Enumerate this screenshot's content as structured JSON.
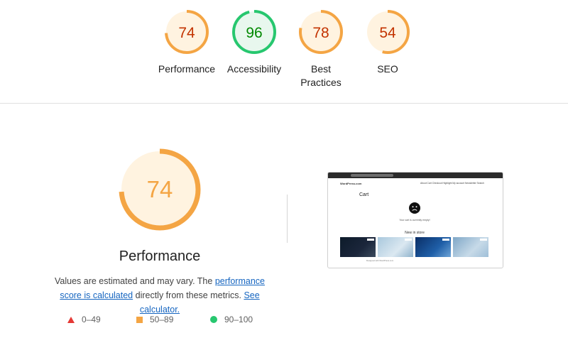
{
  "scores": [
    {
      "label": "Performance",
      "score": "74",
      "value": 0.74,
      "color": "#f4a544",
      "bg": "#fff3e0",
      "text_color": "#c33300"
    },
    {
      "label": "Accessibility",
      "score": "96",
      "value": 0.96,
      "color": "#27c76f",
      "bg": "#e8f7ee",
      "text_color": "#008800"
    },
    {
      "label": "Best Practices",
      "score": "78",
      "value": 0.78,
      "color": "#f4a544",
      "bg": "#fff3e0",
      "text_color": "#c33300"
    },
    {
      "label": "SEO",
      "score": "54",
      "value": 0.54,
      "color": "#f4a544",
      "bg": "#fff3e0",
      "text_color": "#c33300"
    }
  ],
  "performance": {
    "score": "74",
    "value": 0.74,
    "title": "Performance",
    "desc_prefix": "Values are estimated and may vary. The ",
    "link_score": "performance score is calculated",
    "desc_middle": " directly from these metrics. ",
    "link_calculator": "See calculator.",
    "ring_color": "#f4a544",
    "ring_bg": "#fff3e0",
    "score_color": "#f4a544"
  },
  "legend": [
    {
      "shape": "triangle",
      "range": "0–49",
      "color": "#e53935"
    },
    {
      "shape": "square",
      "range": "50–89",
      "color": "#f4a544"
    },
    {
      "shape": "circle",
      "range": "90–100",
      "color": "#27c76f"
    }
  ],
  "screenshot": {
    "brand": "WordPress.com",
    "nav_links": "About  Cart  Checkout  Highlight  My account  Newsletter  Search",
    "cart_title": "Cart",
    "empty_message": "Your cart is currently empty!",
    "new_in_store": "New in store",
    "footer": "Designed with WordPress.com"
  }
}
